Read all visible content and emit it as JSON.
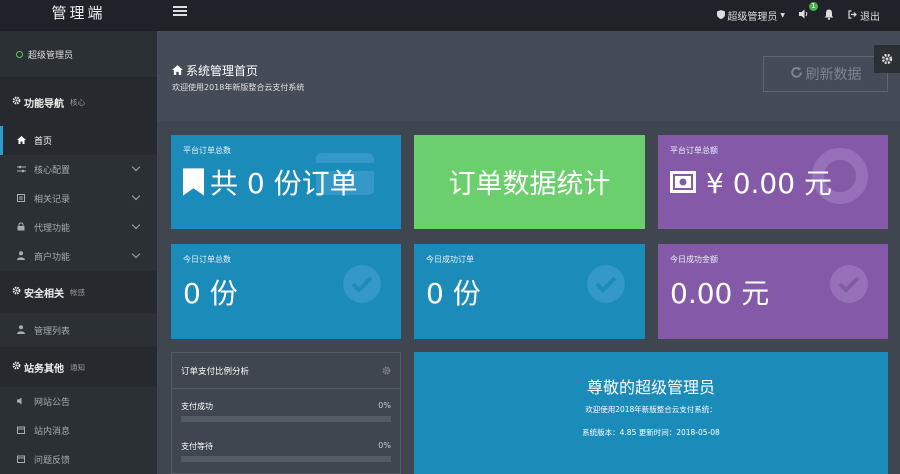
{
  "brand": "管理端",
  "topnav": {
    "user_menu": "超级管理员",
    "notification_badge": "1",
    "logout": "退出"
  },
  "sidebar": {
    "user": "超级管理员",
    "sections": [
      {
        "title": "功能导航",
        "sub": "核心"
      },
      {
        "title": "安全相关",
        "sub": "帐感"
      },
      {
        "title": "站务其他",
        "sub": "通知"
      }
    ],
    "items": [
      {
        "label": "首页",
        "icon": "home-icon"
      },
      {
        "label": "核心配置",
        "icon": "sliders-icon"
      },
      {
        "label": "相关记录",
        "icon": "list-icon"
      },
      {
        "label": "代理功能",
        "icon": "lock-icon"
      },
      {
        "label": "商户功能",
        "icon": "user-icon"
      },
      {
        "label": "管理列表",
        "icon": "user-list-icon"
      },
      {
        "label": "网站公告",
        "icon": "volume-icon"
      },
      {
        "label": "站内消息",
        "icon": "calendar-icon"
      },
      {
        "label": "问题反馈",
        "icon": "calendar-icon"
      }
    ]
  },
  "header": {
    "title": "系统管理首页",
    "subtitle": "欢迎使用2018年新版整合云支付系统",
    "refresh": "刷新数据"
  },
  "cards": {
    "total_orders": {
      "label": "平台订单总数",
      "value": "共 0 份订单"
    },
    "stats": {
      "value": "订单数据统计"
    },
    "total_amount": {
      "label": "平台订单总额",
      "value": "¥  0.00 元"
    },
    "today_orders": {
      "label": "今日订单总数",
      "value": "0 份"
    },
    "today_success": {
      "label": "今日成功订单",
      "value": "0 份"
    },
    "today_money": {
      "label": "今日成功金额",
      "value": "0.00 元"
    }
  },
  "panel": {
    "title": "订单支付比例分析",
    "rows": [
      {
        "label": "支付成功",
        "pct": "0%",
        "fraction": 0
      },
      {
        "label": "支付等待",
        "pct": "0%",
        "fraction": 0
      }
    ]
  },
  "welcome": {
    "title": "尊敬的超级管理员",
    "line1": "欢迎使用2018年新版整合云支付系统：",
    "line2": "系统版本：4.85 更新时间：2018-05-08"
  },
  "colors": {
    "blue": "#1b8bb9",
    "green": "#6ccf6d",
    "purple": "#8459a8",
    "accent": "#2f9bcf"
  }
}
